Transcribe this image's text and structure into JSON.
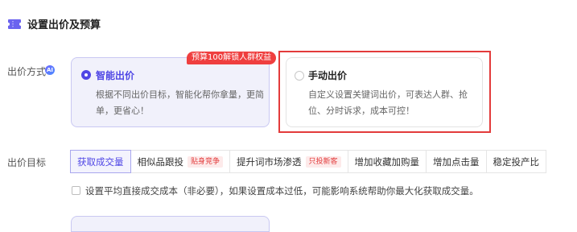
{
  "section": {
    "title": "设置出价及预算",
    "icon": "ticket-icon"
  },
  "bid_method": {
    "label": "出价方式",
    "ai_badge": "AI",
    "promo_tag": "预算100解锁人群权益",
    "options": [
      {
        "title": "智能出价",
        "desc": "根据不同出价目标，智能化帮你拿量，更简单，更省心！",
        "selected": true
      },
      {
        "title": "手动出价",
        "desc": "自定义设置关键词出价，可表达人群、抢位、分时诉求，成本可控！",
        "selected": false
      }
    ]
  },
  "bid_goal": {
    "label": "出价目标",
    "tabs": [
      {
        "label": "获取成交量",
        "tag": "",
        "active": true
      },
      {
        "label": "相似品跟投",
        "tag": "贴身竞争",
        "active": false
      },
      {
        "label": "提升词市场渗透",
        "tag": "只投新客",
        "active": false
      },
      {
        "label": "增加收藏加购量",
        "tag": "",
        "active": false
      },
      {
        "label": "增加点击量",
        "tag": "",
        "active": false
      },
      {
        "label": "稳定投产比",
        "tag": "",
        "active": false
      }
    ]
  },
  "cost_limit": {
    "label": "设置平均直接成交成本（非必要），如果设置成本过低，可能影响系统帮助你最大化获取成交量。",
    "checked": false
  },
  "colors": {
    "accent": "#4f46e5",
    "promo": "#ef3f3f",
    "highlight": "#e33b3b"
  }
}
